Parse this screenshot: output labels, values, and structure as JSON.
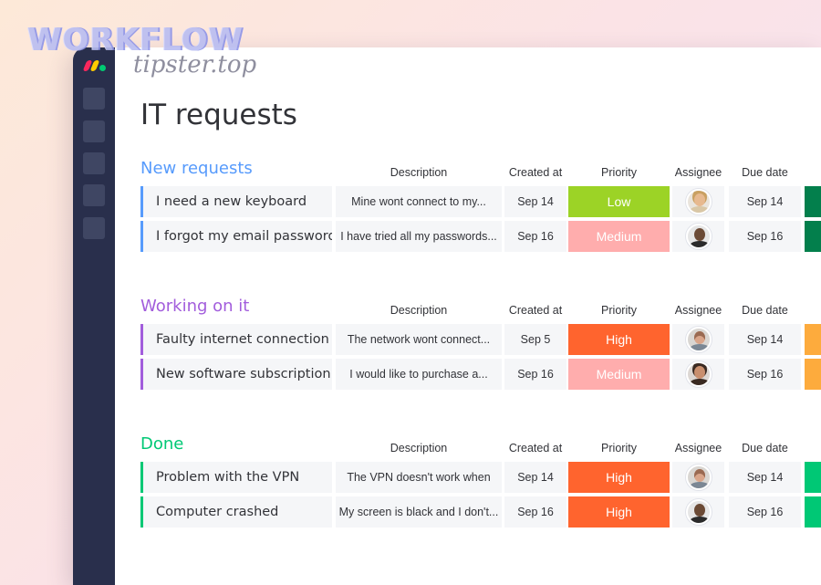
{
  "watermark": {
    "title": "WORKFLOW",
    "subtitle": "tipster.top"
  },
  "page": {
    "title": "IT requests"
  },
  "columns": {
    "description": "Description",
    "created_at": "Created at",
    "priority": "Priority",
    "assignee": "Assignee",
    "due_date": "Due date"
  },
  "colors": {
    "sidebar": "#292f4c",
    "group_new": "#579bfc",
    "group_working": "#a25ddc",
    "group_done": "#00c875",
    "priority_low": "#9cd326",
    "priority_medium": "#ffadad",
    "priority_high": "#ff642e",
    "status_green_dark": "#037f4c",
    "status_orange": "#fdab3d",
    "status_green": "#00c875"
  },
  "groups": [
    {
      "title": "New requests",
      "rows": [
        {
          "name": "I need a new keyboard",
          "description": "Mine wont connect to my...",
          "created": "Sep 14",
          "priority": "Low",
          "assignee": "avatar-woman-blonde",
          "due": "Sep 14"
        },
        {
          "name": "I forgot my email password",
          "description": "I have tried all my passwords...",
          "created": "Sep 16",
          "priority": "Medium",
          "assignee": "avatar-man-bald",
          "due": "Sep 16"
        }
      ]
    },
    {
      "title": "Working on it",
      "rows": [
        {
          "name": "Faulty internet connection",
          "description": "The network wont connect...",
          "created": "Sep 5",
          "priority": "High",
          "assignee": "avatar-man-beard",
          "due": "Sep 14"
        },
        {
          "name": "New software subscription",
          "description": "I would like to purchase a...",
          "created": "Sep 16",
          "priority": "Medium",
          "assignee": "avatar-woman-dark",
          "due": "Sep 16"
        }
      ]
    },
    {
      "title": "Done",
      "rows": [
        {
          "name": "Problem with the VPN",
          "description": "The VPN doesn't work when",
          "created": "Sep 14",
          "priority": "High",
          "assignee": "avatar-man-beard",
          "due": "Sep 14"
        },
        {
          "name": "Computer crashed",
          "description": "My screen is black and I don't...",
          "created": "Sep 16",
          "priority": "High",
          "assignee": "avatar-man-bald",
          "due": "Sep 16"
        }
      ]
    }
  ]
}
